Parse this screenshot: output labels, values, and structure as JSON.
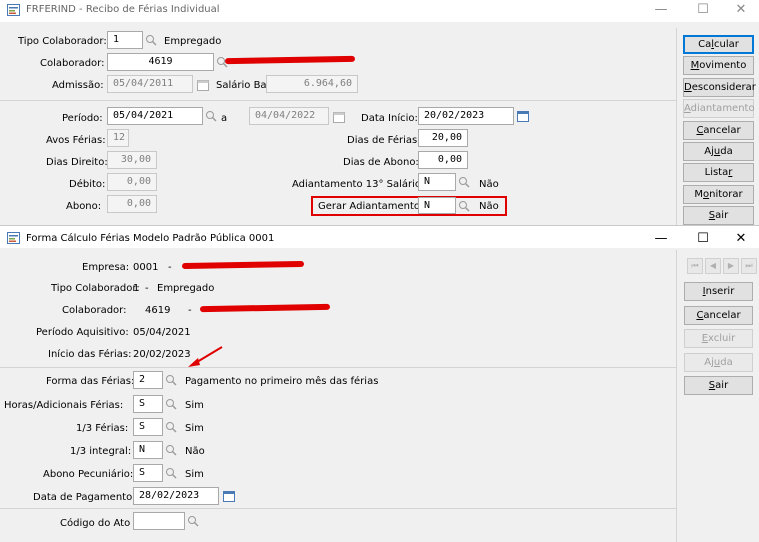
{
  "win1": {
    "title": "FRFERIND - Recibo de Férias Individual",
    "controls": {
      "minimize": "—",
      "maximize": "☐",
      "close": "✕"
    },
    "tipo_colaborador_label": "Tipo Colaborador:",
    "tipo_colaborador_value": "1",
    "tipo_colaborador_desc": "Empregado",
    "colaborador_label": "Colaborador:",
    "colaborador_value": "4619",
    "admissao_label": "Admissão:",
    "admissao_value": "05/04/2011",
    "salario_label": "Salário Base:",
    "salario_value": "6.964,60",
    "periodo_label": "Período:",
    "periodo_inicio": "05/04/2021",
    "periodo_a": "a",
    "periodo_fim": "04/04/2022",
    "data_inicio_label": "Data Início:",
    "data_inicio_value": "20/02/2023",
    "avos_label": "Avos Férias:",
    "avos_value": "12",
    "dias_ferias_label": "Dias de Férias:",
    "dias_ferias_value": "20,00",
    "dias_direito_label": "Dias Direito:",
    "dias_direito_value": "30,00",
    "dias_abono_label": "Dias de Abono:",
    "dias_abono_value": "0,00",
    "debito_label": "Débito:",
    "debito_value": "0,00",
    "adiant13_label": "Adiantamento 13° Salário:",
    "adiant13_value": "N",
    "adiant13_desc": "Não",
    "abono_label": "Abono:",
    "abono_value": "0,00",
    "gerar_label": "Gerar Adiantamento:",
    "gerar_value": "N",
    "gerar_desc": "Não",
    "buttons": [
      {
        "pre": "Ca",
        "u": "l",
        "post": "cular",
        "state": "default"
      },
      {
        "pre": "",
        "u": "M",
        "post": "ovimento",
        "state": "normal"
      },
      {
        "pre": "",
        "u": "D",
        "post": "esconsiderar",
        "state": "normal"
      },
      {
        "pre": "",
        "u": "A",
        "post": "diantamento",
        "state": "disabled"
      },
      {
        "pre": "",
        "u": "C",
        "post": "ancelar",
        "state": "normal"
      },
      {
        "pre": "Aj",
        "u": "u",
        "post": "da",
        "state": "normal"
      },
      {
        "pre": "Lista",
        "u": "r",
        "post": "",
        "state": "normal"
      },
      {
        "pre": "M",
        "u": "o",
        "post": "nitorar",
        "state": "normal"
      },
      {
        "pre": "",
        "u": "S",
        "post": "air",
        "state": "normal"
      }
    ]
  },
  "win2": {
    "title": "Forma Cálculo Férias Modelo Padrão Pública 0001",
    "controls": {
      "minimize": "—",
      "maximize": "☐",
      "close": "✕"
    },
    "empresa_label": "Empresa:",
    "empresa_value": "0001",
    "tipo_label": "Tipo Colaborador:",
    "tipo_value": "1",
    "tipo_dash": "-",
    "tipo_desc": "Empregado",
    "colaborador_label": "Colaborador:",
    "colaborador_value": "4619",
    "dash": "-",
    "periodo_aq_label": "Período Aquisitivo:",
    "periodo_aq_value": "05/04/2021",
    "inicio_label": "Início das Férias:",
    "inicio_value": "20/02/2023",
    "forma_label": "Forma das Férias:",
    "forma_value": "2",
    "forma_desc": "Pagamento no primeiro mês das férias",
    "horas_label": "Horas/Adicionais Férias:",
    "horas_value": "S",
    "horas_desc": "Sim",
    "terco_label": "1/3 Férias:",
    "terco_value": "S",
    "terco_desc": "Sim",
    "terco_int_label": "1/3 integral:",
    "terco_int_value": "N",
    "terco_int_desc": "Não",
    "abono_pec_label": "Abono Pecuniário:",
    "abono_pec_value": "S",
    "abono_pec_desc": "Sim",
    "data_pag_label": "Data de Pagamento:",
    "data_pag_value": "28/02/2023",
    "codigo_ato_label": "Código do Ato",
    "codigo_ato_value": "",
    "nav": [
      "⏮",
      "◀",
      "▶",
      "⏭"
    ],
    "buttons": [
      {
        "pre": "",
        "u": "I",
        "post": "nserir",
        "state": "normal"
      },
      {
        "pre": "",
        "u": "C",
        "post": "ancelar",
        "state": "normal"
      },
      {
        "pre": "",
        "u": "E",
        "post": "xcluir",
        "state": "disabled"
      },
      {
        "pre": "Aj",
        "u": "u",
        "post": "da",
        "state": "disabled"
      },
      {
        "pre": "",
        "u": "S",
        "post": "air",
        "state": "normal"
      }
    ]
  },
  "colors": {
    "accent": "#0078d7",
    "highlight": "#e00000"
  }
}
